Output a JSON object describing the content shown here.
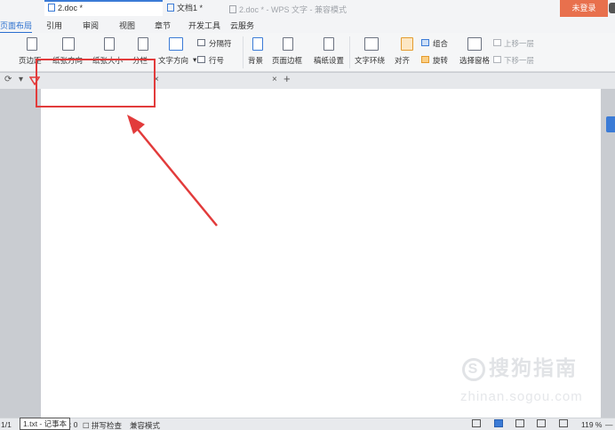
{
  "window": {
    "title": "2.doc * - WPS 文字 - 兼容模式",
    "login_label": "未登录"
  },
  "menu": {
    "tabs": [
      "页面布局",
      "引用",
      "审阅",
      "视图",
      "章节",
      "开发工具",
      "云服务"
    ],
    "active": "页面布局"
  },
  "ribbon": {
    "margins": "页边距",
    "orientation": "纸张方向",
    "size": "纸张大小",
    "columns": "分栏",
    "text_direction": "文字方向",
    "breaks": "分隔符",
    "line_numbers": "行号",
    "background": "背景",
    "page_border": "页面边框",
    "manuscript": "稿纸设置",
    "wrap_text": "文字环绕",
    "align": "对齐",
    "group": "组合",
    "rotate": "旋转",
    "selection_pane": "选择窗格",
    "bring_forward": "上移一层",
    "send_backward": "下移一层"
  },
  "doc_tabs": [
    {
      "label": "2.doc *",
      "active": true
    },
    {
      "label": "文档1 *",
      "active": false
    }
  ],
  "tab_controls": {
    "close": "×",
    "new": "+",
    "dropdown": "▾"
  },
  "watermark": {
    "brand": "搜狗指南",
    "site": "zhinan.sogou.com"
  },
  "statusbar": {
    "page": "1/1",
    "tooltip": "1.txt - 记事本",
    "word_count_tail": ": 0",
    "spell_check": "拼写检查",
    "compat_mode": "兼容模式",
    "zoom": "119 %",
    "zoom_out": "—"
  },
  "colors": {
    "accent": "#3b7bd6",
    "login": "#e8704d",
    "highlight": "#e23b3b"
  }
}
